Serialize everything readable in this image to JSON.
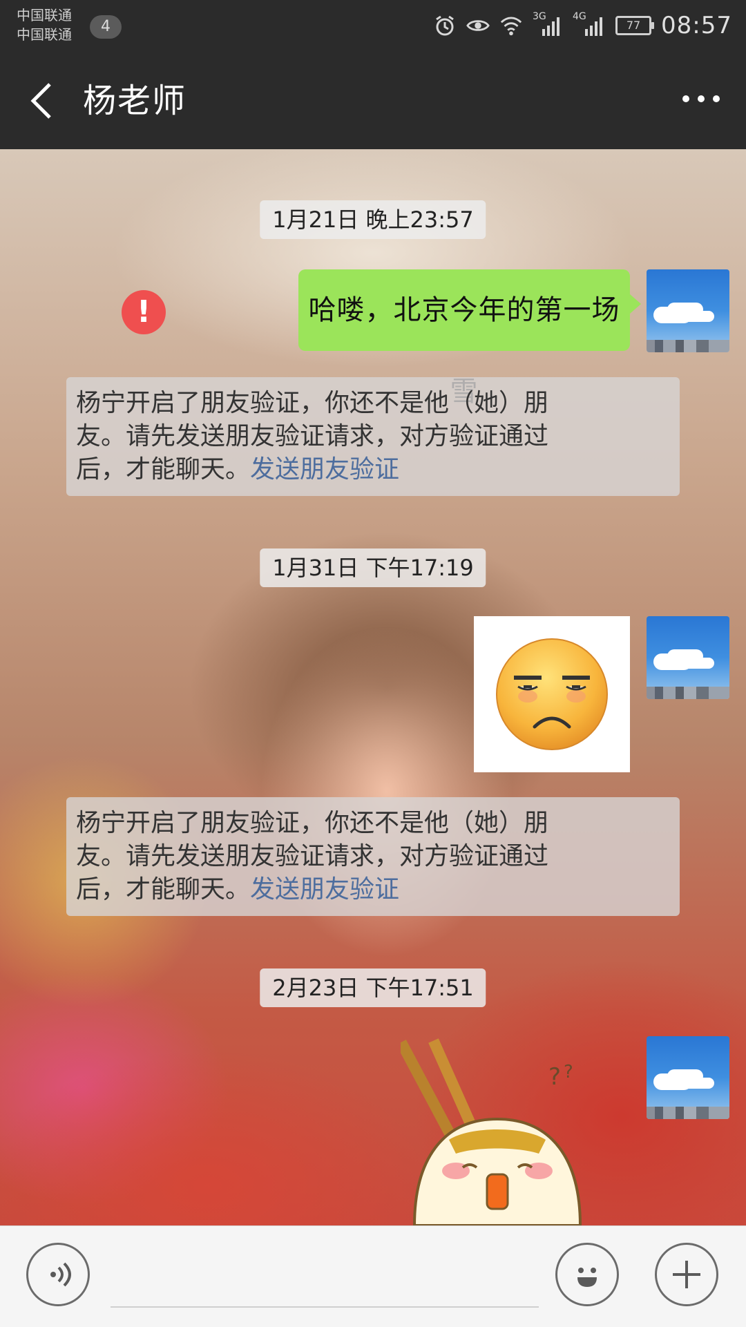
{
  "status_bar": {
    "carrier_1": "中国联通",
    "carrier_2": "中国联通",
    "sim_badge": "4",
    "network_3g": "3G",
    "network_4g": "4G",
    "battery": "77",
    "time": "08:57"
  },
  "header": {
    "title": "杨老师"
  },
  "messages": [
    {
      "type": "timestamp",
      "text": "1月21日 晚上23:57"
    },
    {
      "type": "text_outgoing",
      "text": "哈喽，北京今年的第一场雪",
      "status": "send-failed"
    },
    {
      "type": "system",
      "text_lines": [
        "杨宁开启了朋友验证，你还不是他（她）朋",
        "友。请先发送朋友验证请求，对方验证通过",
        "后，才能聊天。"
      ],
      "link": "发送朋友验证"
    },
    {
      "type": "timestamp",
      "text": "1月31日 下午17:19"
    },
    {
      "type": "emoji_outgoing",
      "emoji": "unamused-face"
    },
    {
      "type": "system",
      "text_lines": [
        "杨宁开启了朋友验证，你还不是他（她）朋",
        "友。请先发送朋友验证请求，对方验证通过",
        "后，才能聊天。"
      ],
      "link": "发送朋友验证"
    },
    {
      "type": "timestamp",
      "text": "2月23日 下午17:51"
    },
    {
      "type": "sticker_outgoing",
      "sticker": "surprised-bun-with-chopsticks"
    }
  ],
  "colors": {
    "bar_bg": "#2b2b2b",
    "bubble_green": "#9be45a",
    "error_red": "#ef4f4f",
    "link_blue": "#4d6d9e"
  }
}
